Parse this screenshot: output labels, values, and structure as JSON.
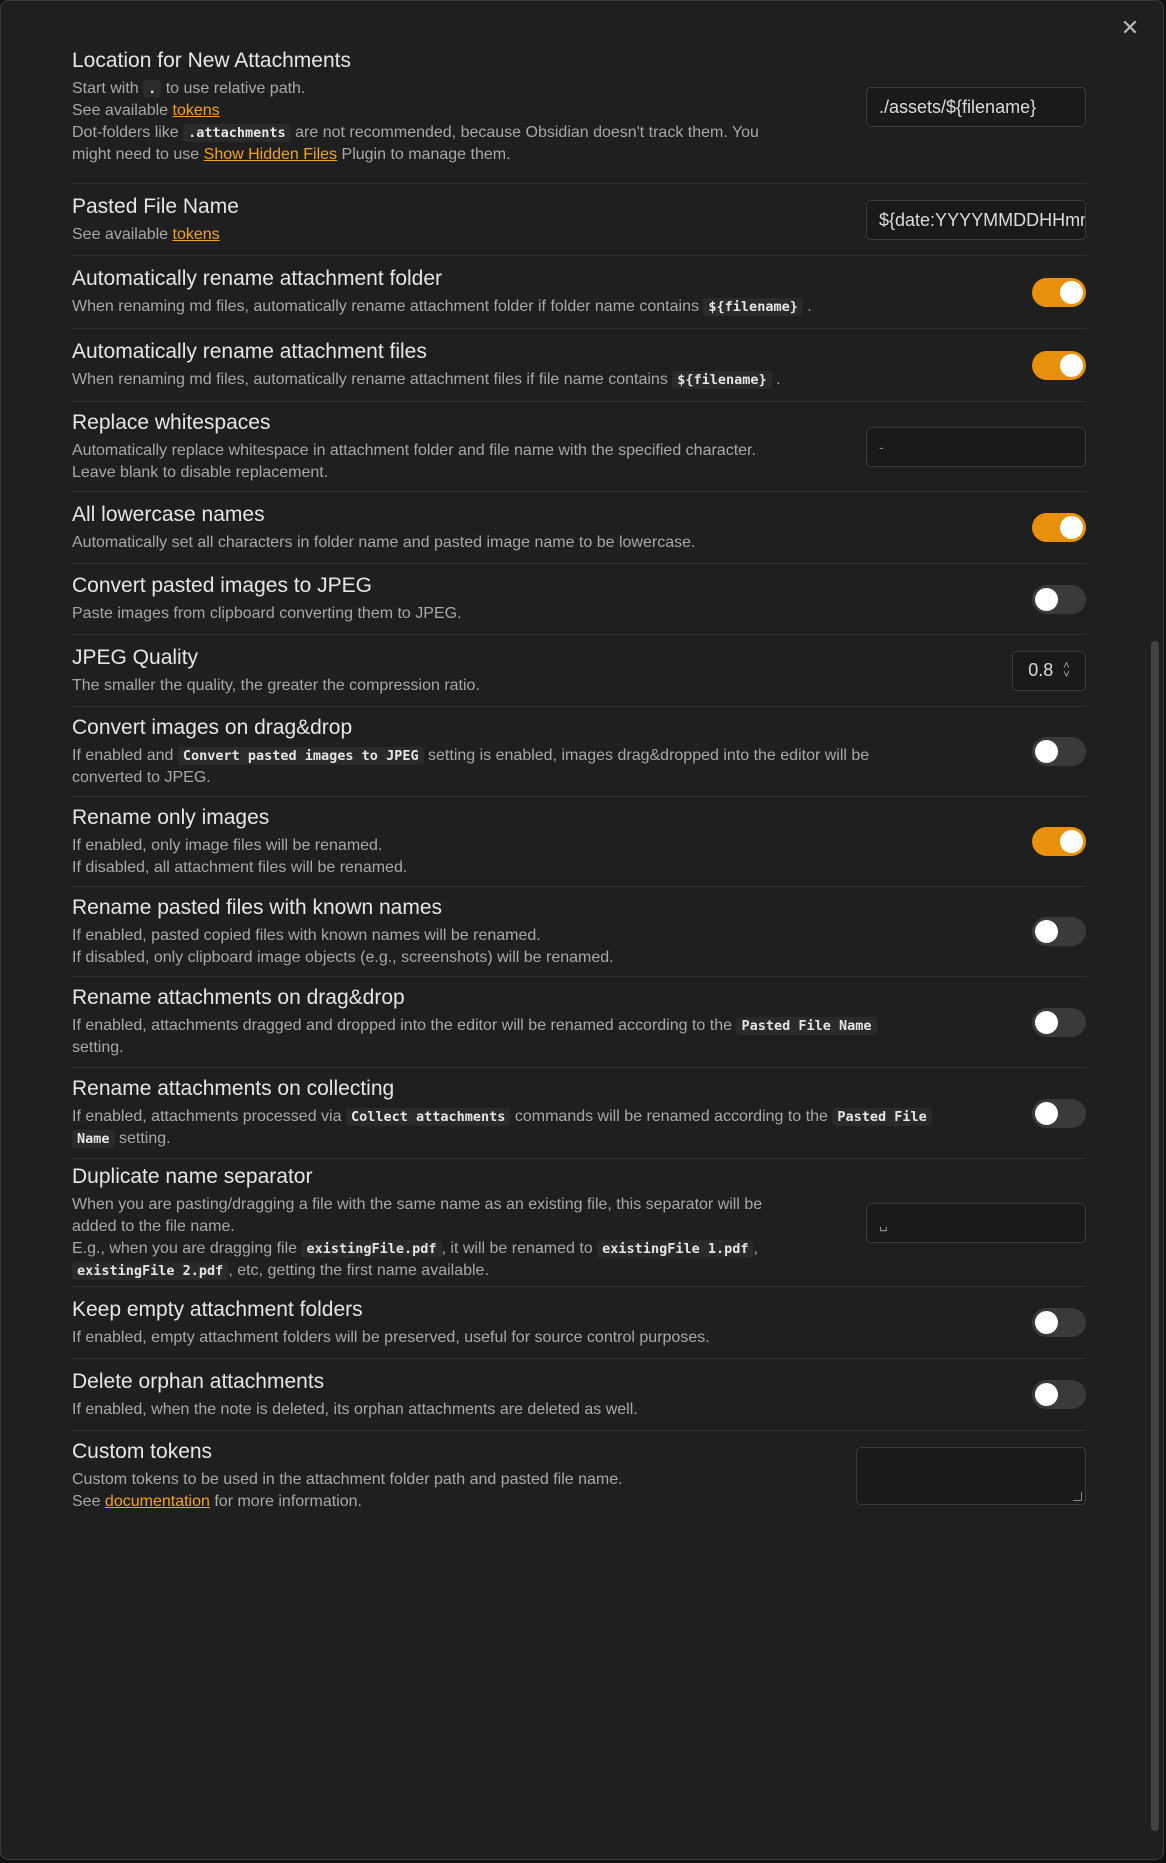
{
  "close_label": "✕",
  "settings": {
    "location": {
      "name": "Location for New Attachments",
      "d1a": "Start with",
      "d1code": ".",
      "d1b": "to use relative path.",
      "d2a": "See available",
      "d2link": "tokens",
      "d3a": "Dot-folders like",
      "d3code": ".attachments",
      "d3b": "are not recommended, because Obsidian doesn't track them. You",
      "d4a": "might need to use",
      "d4link": "Show Hidden Files",
      "d4b": "Plugin to manage them.",
      "value": "./assets/${filename}"
    },
    "pasted_name": {
      "name": "Pasted File Name",
      "d1a": "See available",
      "d1link": "tokens",
      "value": "${date:YYYYMMDDHHmmssSSS}"
    },
    "rename_folder": {
      "name": "Automatically rename attachment folder",
      "da": "When renaming md files, automatically rename attachment folder if folder name contains",
      "dcode": "${filename}",
      "db": "."
    },
    "rename_files": {
      "name": "Automatically rename attachment files",
      "da": "When renaming md files, automatically rename attachment files if file name contains",
      "dcode": "${filename}",
      "db": "."
    },
    "whitespace": {
      "name": "Replace whitespaces",
      "d1": "Automatically replace whitespace in attachment folder and file name with the specified character.",
      "d2": "Leave blank to disable replacement.",
      "value": "-"
    },
    "lowercase": {
      "name": "All lowercase names",
      "d1": "Automatically set all characters in folder name and pasted image name to be lowercase."
    },
    "jpeg": {
      "name": "Convert pasted images to JPEG",
      "d1": "Paste images from clipboard converting them to JPEG."
    },
    "quality": {
      "name": "JPEG Quality",
      "d1": "The smaller the quality, the greater the compression ratio.",
      "value": "0.8"
    },
    "dragdrop_convert": {
      "name": "Convert images on drag&drop",
      "da": "If enabled and",
      "dcode": "Convert pasted images to JPEG",
      "db": "setting is enabled, images drag&dropped into the editor will be",
      "d2": "converted to JPEG."
    },
    "only_images": {
      "name": "Rename only images",
      "d1": "If enabled, only image files will be renamed.",
      "d2": "If disabled, all attachment files will be renamed."
    },
    "known_names": {
      "name": "Rename pasted files with known names",
      "d1": "If enabled, pasted copied files with known names will be renamed.",
      "d2": "If disabled, only clipboard image objects (e.g., screenshots) will be renamed."
    },
    "rename_drag": {
      "name": "Rename attachments on drag&drop",
      "da": "If enabled, attachments dragged and dropped into the editor will be renamed according to the",
      "dcode": "Pasted File Name",
      "d2": "setting."
    },
    "rename_collect": {
      "name": "Rename attachments on collecting",
      "da": "If enabled, attachments processed via",
      "dcode1": "Collect attachments",
      "db": "commands will be renamed according to the",
      "dcode2a": "Pasted File",
      "dcode2b": "Name",
      "dc": "setting."
    },
    "dup_sep": {
      "name": "Duplicate name separator",
      "d1": "When you are pasting/dragging a file with the same name as an existing file, this separator will be",
      "d2": "added to the file name.",
      "d3a": "E.g., when you are dragging file",
      "d3code1": "existingFile.pdf",
      "d3b": ", it will be renamed to",
      "d3code2": "existingFile 1.pdf",
      "d3c": ",",
      "d4code": "existingFile 2.pdf",
      "d4a": ", etc, getting the first name available.",
      "value": "␣"
    },
    "keep_empty": {
      "name": "Keep empty attachment folders",
      "d1": "If enabled, empty attachment folders will be preserved, useful for source control purposes."
    },
    "delete_orphan": {
      "name": "Delete orphan attachments",
      "d1": "If enabled, when the note is deleted, its orphan attachments are deleted as well."
    },
    "custom_tokens": {
      "name": "Custom tokens",
      "d1": "Custom tokens to be used in the attachment folder path and pasted file name.",
      "d2a": "See",
      "d2link": "documentation",
      "d2b": "for more information."
    }
  },
  "toggles": {
    "rename_folder": true,
    "rename_files": true,
    "lowercase": true,
    "jpeg": false,
    "dragdrop_convert": false,
    "only_images": true,
    "known_names": false,
    "rename_drag": false,
    "rename_collect": false,
    "keep_empty": false,
    "delete_orphan": false
  },
  "colors": {
    "accent": "#e8900c",
    "link": "#f5a31a",
    "background": "#1f1f1f"
  }
}
